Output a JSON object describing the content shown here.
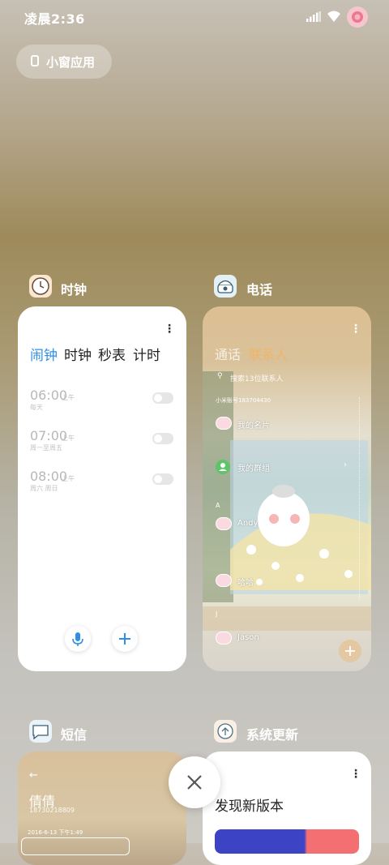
{
  "status_bar": {
    "time": "凌晨2:36"
  },
  "mini_window": {
    "label": "小窗应用"
  },
  "apps": {
    "clock": {
      "title": "时钟",
      "tabs": [
        "闹钟",
        "时钟",
        "秒表",
        "计时"
      ],
      "alarms": [
        {
          "time": "06:00",
          "ampm": "上午",
          "repeat": "每天"
        },
        {
          "time": "07:00",
          "ampm": "上午",
          "repeat": "周一至周五"
        },
        {
          "time": "08:00",
          "ampm": "上午",
          "repeat": "周六 周日"
        }
      ]
    },
    "phone": {
      "title": "电话",
      "tabs": [
        "通话",
        "联系人"
      ],
      "search_placeholder": "搜索13位联系人",
      "account": "小米账号183704430",
      "contacts": [
        "我的名片",
        "我的群组",
        "Andy",
        "哈哈",
        "Jason"
      ],
      "section_letters": [
        "A",
        "J"
      ]
    },
    "sms": {
      "title": "短信",
      "contact_name": "倩倩",
      "contact_number": "18730218809",
      "timestamp": "2016-6-13 下午1:49"
    },
    "update": {
      "title": "系统更新",
      "heading": "发现新版本"
    }
  },
  "colors": {
    "accent": "#2f8fe8",
    "phone_accent": "#f2b466",
    "update_gradient_start": "#3c43c4",
    "update_gradient_end": "#f36f72"
  }
}
